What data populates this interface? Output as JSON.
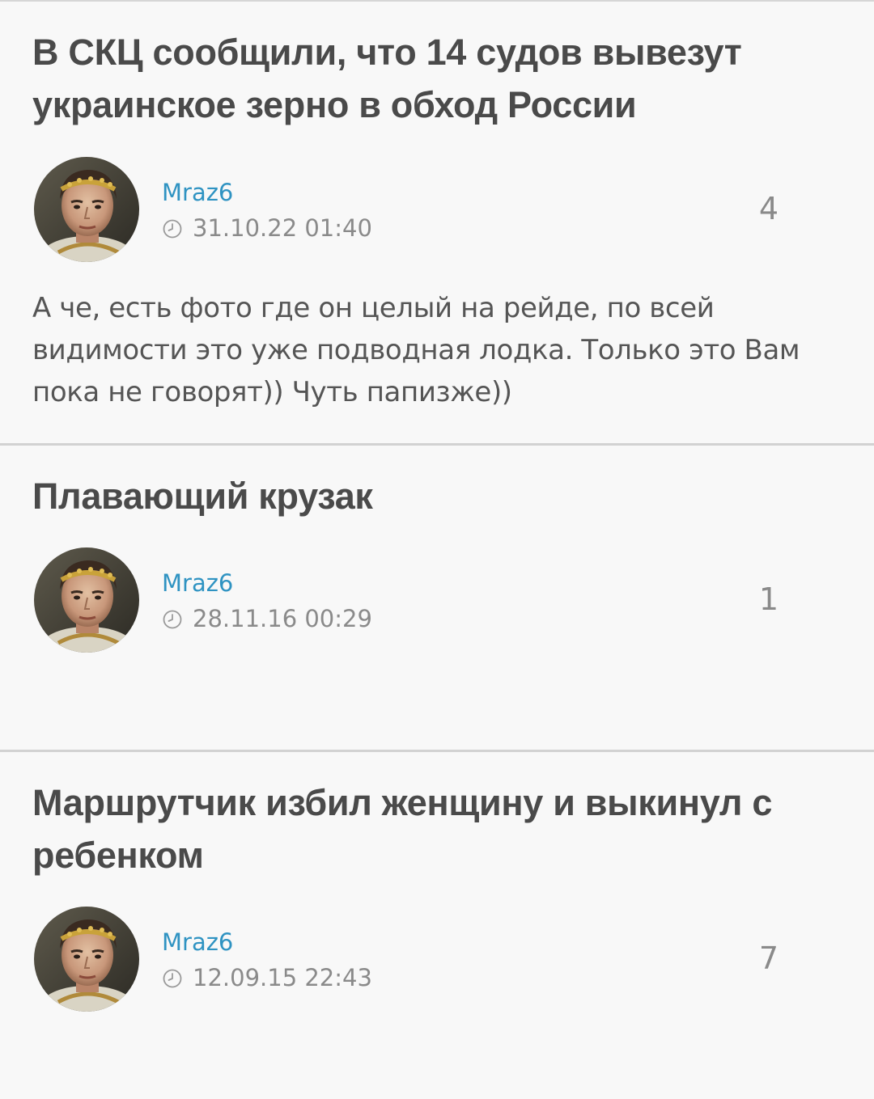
{
  "posts": [
    {
      "title": "В СКЦ сообщили, что 14 судов вывезут украинское зерно в обход России",
      "author": "Mraz6",
      "datetime": "31.10.22 01:40",
      "comment_count": "4",
      "snippet": "А че, есть фото где он целый на рейде, по всей видимости это уже подводная лодка. Только это Вам пока не говорят)) Чуть папизже))"
    },
    {
      "title": "Плавающий крузак",
      "author": "Mraz6",
      "datetime": "28.11.16 00:29",
      "comment_count": "1"
    },
    {
      "title": "Маршрутчик избил женщину и выкинул с ребенком",
      "author": "Mraz6",
      "datetime": "12.09.15 22:43",
      "comment_count": "7"
    }
  ],
  "icons": {
    "clock": "clock-icon",
    "avatar": "avatar-image"
  },
  "colors": {
    "background": "#f8f8f8",
    "title": "#4a4a4a",
    "author_link": "#2f93c2",
    "meta": "#8a8a8a",
    "divider": "#d2d2d2"
  }
}
